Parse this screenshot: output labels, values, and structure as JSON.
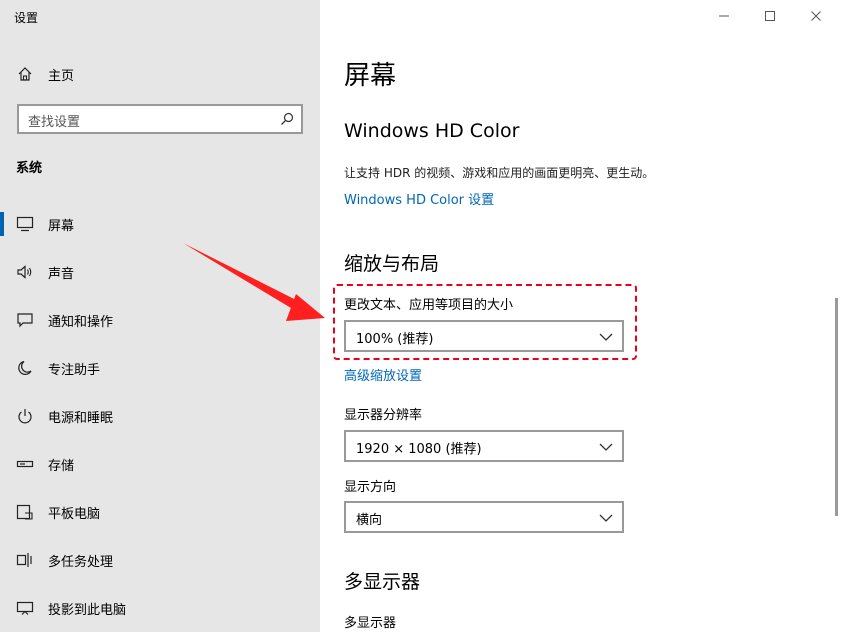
{
  "window": {
    "title": "设置",
    "controls": [
      "minimize-icon",
      "maximize-icon",
      "close-icon"
    ]
  },
  "sidebar": {
    "home_label": "主页",
    "search_placeholder": "查找设置",
    "section_title": "系统",
    "items": [
      {
        "label": "屏幕",
        "icon": "monitor-icon",
        "active": true
      },
      {
        "label": "声音",
        "icon": "speaker-icon"
      },
      {
        "label": "通知和操作",
        "icon": "notification-icon"
      },
      {
        "label": "专注助手",
        "icon": "moon-icon"
      },
      {
        "label": "电源和睡眠",
        "icon": "power-icon"
      },
      {
        "label": "存储",
        "icon": "storage-icon"
      },
      {
        "label": "平板电脑",
        "icon": "tablet-icon"
      },
      {
        "label": "多任务处理",
        "icon": "multitask-icon"
      },
      {
        "label": "投影到此电脑",
        "icon": "project-icon"
      }
    ]
  },
  "main": {
    "title": "屏幕",
    "hdr": {
      "heading": "Windows HD Color",
      "description": "让支持 HDR 的视频、游戏和应用的画面更明亮、更生动。",
      "link": "Windows HD Color 设置"
    },
    "scale": {
      "heading": "缩放与布局",
      "scale_label": "更改文本、应用等项目的大小",
      "scale_value": "100% (推荐)",
      "advanced_link": "高级缩放设置",
      "resolution_label": "显示器分辨率",
      "resolution_value": "1920 × 1080 (推荐)",
      "orientation_label": "显示方向",
      "orientation_value": "横向"
    },
    "multi": {
      "heading": "多显示器",
      "label": "多显示器"
    }
  },
  "colors": {
    "accent": "#0063b1",
    "link": "#0067b8",
    "highlight": "#e8001c",
    "sidebar_bg": "#e6e6e6"
  }
}
